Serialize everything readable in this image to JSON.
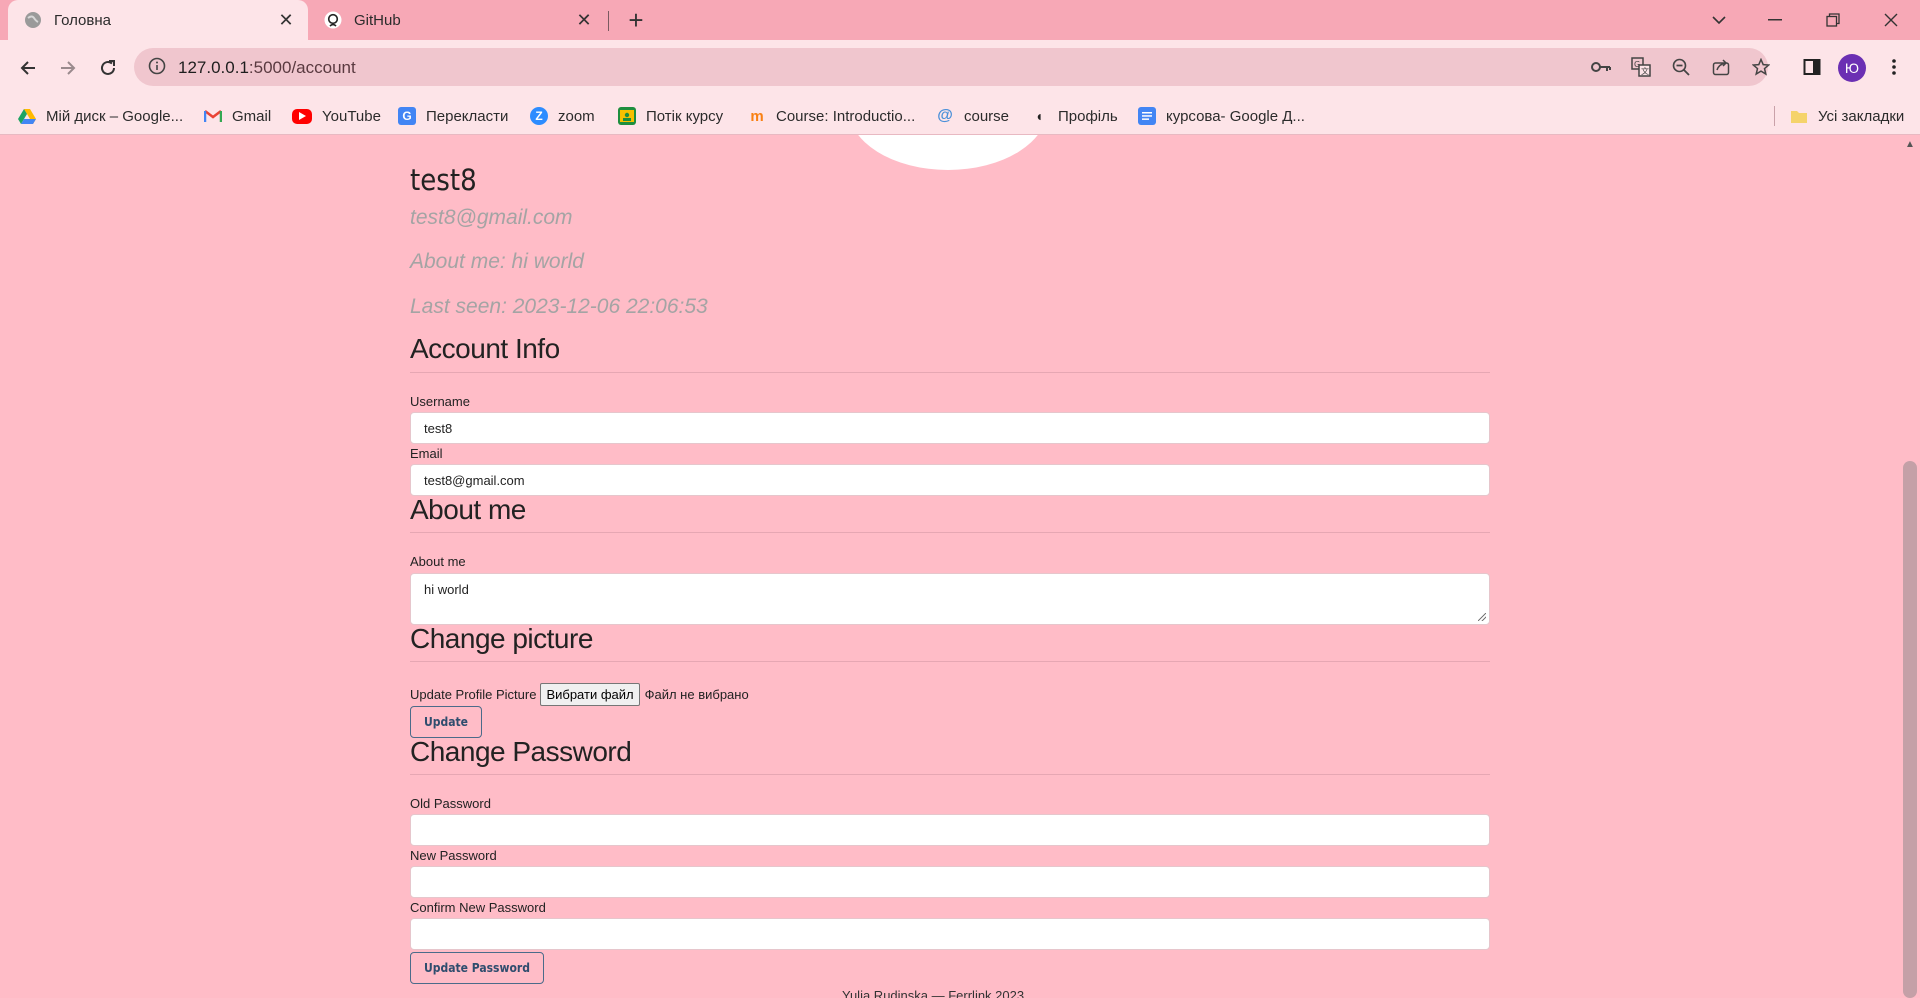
{
  "browser": {
    "tabs": [
      {
        "title": "Головна",
        "active": true,
        "icon": "globe-icon"
      },
      {
        "title": "GitHub",
        "active": false,
        "icon": "github-icon"
      }
    ],
    "url_host": "127.0.0.1",
    "url_path": ":5000/account",
    "profile_initial": "Ю",
    "bookmarks": [
      {
        "label": "Мій диск – Google...",
        "icon": "google-drive-icon",
        "color": "#1fa463"
      },
      {
        "label": "Gmail",
        "icon": "gmail-icon",
        "color": "#ea4335"
      },
      {
        "label": "YouTube",
        "icon": "youtube-icon",
        "color": "#ff0000"
      },
      {
        "label": "Перекласти",
        "icon": "translate-icon",
        "color": "#4285f4"
      },
      {
        "label": "zoom",
        "icon": "zoom-icon",
        "color": "#2d8cff"
      },
      {
        "label": "Потік курсу",
        "icon": "classroom-icon",
        "color": "#1e8e3e"
      },
      {
        "label": "Course: Introductio...",
        "icon": "moodle-icon",
        "color": "#f98012"
      },
      {
        "label": "course",
        "icon": "course-icon",
        "color": "#4a90d9"
      },
      {
        "label": "Профіль",
        "icon": "profile-icon",
        "color": "#222222"
      },
      {
        "label": "курсова- Google Д...",
        "icon": "google-docs-icon",
        "color": "#4285f4"
      }
    ],
    "all_bookmarks": "Усі закладки"
  },
  "profile": {
    "username": "test8",
    "email": "test8@gmail.com",
    "about": "About me: hi world",
    "last_seen": "Last seen: 2023-12-06 22:06:53"
  },
  "account_info": {
    "heading": "Account Info",
    "username_label": "Username",
    "username_value": "test8",
    "email_label": "Email",
    "email_value": "test8@gmail.com"
  },
  "about_me": {
    "heading": "About me",
    "label": "About me",
    "value": "hi world"
  },
  "change_picture": {
    "heading": "Change picture",
    "label": "Update Profile Picture",
    "choose_button": "Вибрати файл",
    "no_file": "Файл не вибрано",
    "update_button": "Update"
  },
  "change_password": {
    "heading": "Change Password",
    "old_label": "Old Password",
    "new_label": "New Password",
    "confirm_label": "Confirm New Password",
    "submit_button": "Update Password"
  },
  "footer": "Yulia Rudinska — Ferrlink 2023"
}
